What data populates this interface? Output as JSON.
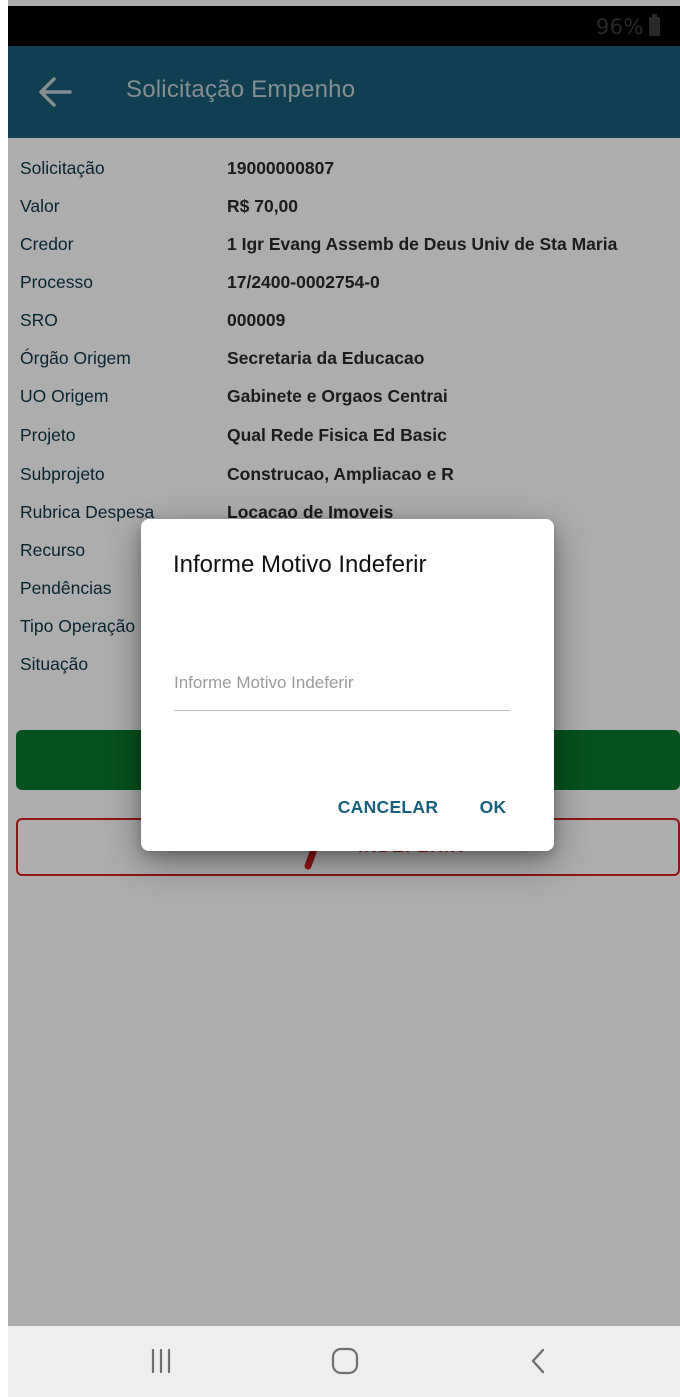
{
  "status_bar": {
    "battery": "96%"
  },
  "app_bar": {
    "title": "Solicitação Empenho"
  },
  "details": [
    {
      "label": "Solicitação",
      "value": "19000000807"
    },
    {
      "label": "Valor",
      "value": "R$ 70,00"
    },
    {
      "label": "Credor",
      "value": "1 Igr Evang Assemb de Deus Univ de Sta Maria"
    },
    {
      "label": "Processo",
      "value": "17/2400-0002754-0"
    },
    {
      "label": "SRO",
      "value": "000009"
    },
    {
      "label": "Órgão Origem",
      "value": "Secretaria da Educacao"
    },
    {
      "label": "UO Origem",
      "value": "Gabinete e Orgaos Centrai"
    },
    {
      "label": "Projeto",
      "value": "Qual Rede Fisica Ed Basic"
    },
    {
      "label": "Subprojeto",
      "value": "Construcao, Ampliacao e R"
    },
    {
      "label": "Rubrica Despesa",
      "value": "Locacao de Imoveis"
    },
    {
      "label": "Recurso",
      "value": ""
    },
    {
      "label": "Pendências",
      "value": ""
    },
    {
      "label": "Tipo Operação",
      "value": ""
    },
    {
      "label": "Situação",
      "value": ""
    }
  ],
  "actions": {
    "reject_label": "INDEFERIR"
  },
  "dialog": {
    "title": "Informe Motivo Indeferir",
    "input_placeholder": "Informe Motivo Indeferir",
    "input_value": "",
    "cancel_label": "CANCELAR",
    "ok_label": "OK"
  },
  "colors": {
    "app_bar": "#1a5d78",
    "approve": "#0a7a2a",
    "reject": "#d51f1f",
    "dialog_button": "#18607e"
  },
  "icons": {
    "back": "arrow-left-icon",
    "reject": "thumbs-down-icon",
    "nav_recents": "recent-apps-icon",
    "nav_home": "home-icon",
    "nav_back": "chevron-left-icon"
  }
}
